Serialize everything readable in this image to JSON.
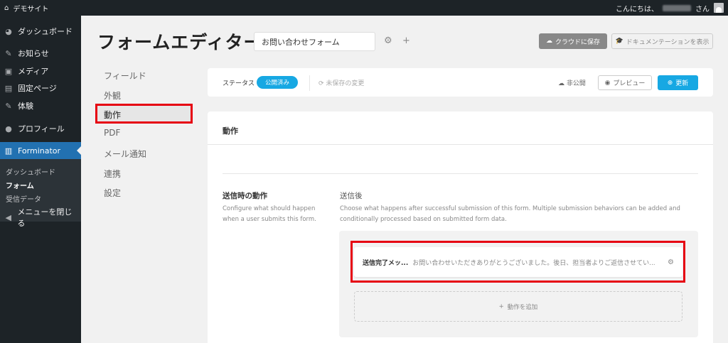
{
  "adminbar": {
    "site_name": "デモサイト",
    "greeting": "こんにちは、",
    "suffix": "さん"
  },
  "sidebar": {
    "items": [
      {
        "label": "ダッシュボード",
        "icon": "dashboard-icon"
      },
      {
        "label": "お知らせ",
        "icon": "pin-icon"
      },
      {
        "label": "メディア",
        "icon": "media-icon"
      },
      {
        "label": "固定ページ",
        "icon": "page-icon"
      },
      {
        "label": "体験",
        "icon": "pin-icon"
      },
      {
        "label": "プロフィール",
        "icon": "user-icon"
      },
      {
        "label": "Forminator",
        "icon": "clipboard-icon"
      }
    ],
    "submenu": [
      "ダッシュボード",
      "フォーム",
      "受信データ"
    ],
    "collapse": "メニューを閉じる"
  },
  "editor": {
    "title": "フォームエディター",
    "form_name": "お問い合わせフォーム",
    "save_cloud": "クラウドに保存",
    "docs": "ドキュメンテーションを表示"
  },
  "nav": {
    "items": [
      "フィールド",
      "外観",
      "動作",
      "PDF",
      "メール通知",
      "連携",
      "設定"
    ],
    "active_index": 2
  },
  "status": {
    "label": "ステータス",
    "badge": "公開済み",
    "unsaved": "未保存の変更",
    "private": "非公開",
    "preview": "プレビュー",
    "update": "更新"
  },
  "behavior": {
    "card_title": "動作",
    "section_title": "送信時の動作",
    "section_desc": "Configure what should happen when a user submits this form.",
    "after_title": "送信後",
    "after_desc": "Choose what happens after successful submission of this form. Multiple submission behaviors can be added and conditionally processed based on submitted form data.",
    "message_title": "送信完了メッ...",
    "message_text": "お問い合わせいただきありがとうございました。後日、担当者よりご返信させてい...",
    "add_action": "動作を追加"
  },
  "colors": {
    "wp_dark": "#1d2327",
    "wp_blue": "#2271b1",
    "accent": "#17a8e3",
    "highlight": "#e60012"
  }
}
